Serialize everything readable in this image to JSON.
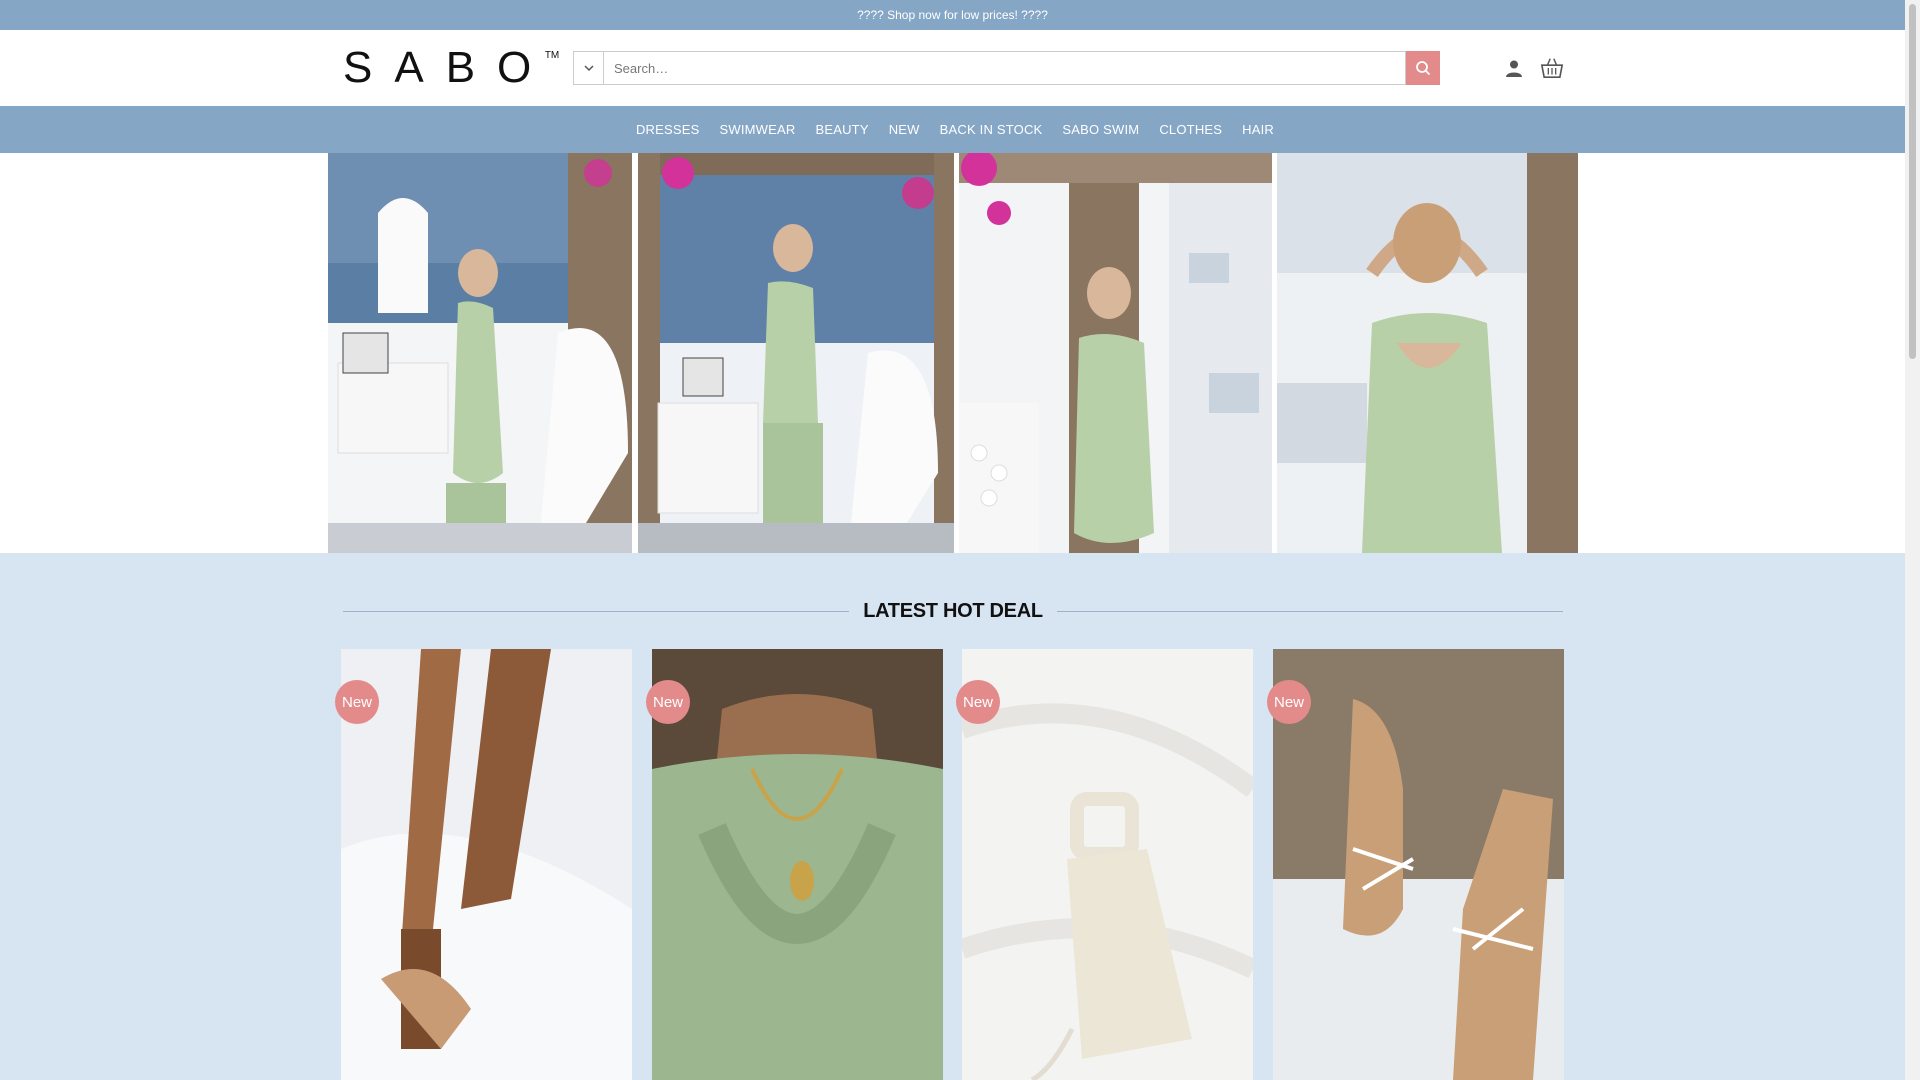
{
  "announcement": "???? Shop now for low prices! ????",
  "logo": {
    "text": "SABO",
    "tm": "TM"
  },
  "search": {
    "placeholder": "Search…",
    "category_icon": "chevron-down-icon",
    "submit_icon": "search-icon"
  },
  "header_icons": {
    "account": "user-icon",
    "cart": "basket-icon"
  },
  "nav": {
    "items": [
      {
        "label": "DRESSES"
      },
      {
        "label": "SWIMWEAR"
      },
      {
        "label": "BEAUTY"
      },
      {
        "label": "NEW"
      },
      {
        "label": "BACK IN STOCK"
      },
      {
        "label": "SABO SWIM"
      },
      {
        "label": "CLOTHES"
      },
      {
        "label": "HAIR"
      }
    ]
  },
  "section": {
    "title": "LATEST HOT DEAL"
  },
  "products": [
    {
      "badge": "New"
    },
    {
      "badge": "New"
    },
    {
      "badge": "New"
    },
    {
      "badge": "New"
    }
  ],
  "colors": {
    "brand_blue": "#86a6c6",
    "accent_pink": "#e38b8b",
    "section_bg": "#d7e5f3",
    "dress_green": "#b8d0a8"
  }
}
